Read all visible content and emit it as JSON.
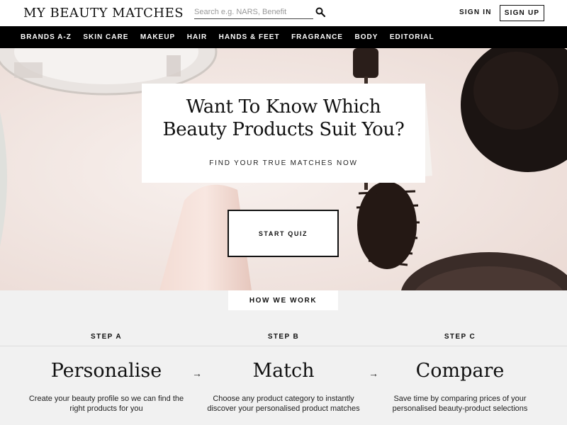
{
  "header": {
    "logo": "MY BEAUTY MATCHES",
    "search_placeholder": "Search e.g. NARS, Benefit",
    "sign_in": "SIGN IN",
    "sign_up": "SIGN UP"
  },
  "nav": {
    "items": [
      "BRANDS A-Z",
      "SKIN CARE",
      "MAKEUP",
      "HAIR",
      "HANDS & FEET",
      "FRAGRANCE",
      "BODY",
      "EDITORIAL"
    ]
  },
  "hero": {
    "title_line1": "Want To Know Which",
    "title_line2": "Beauty Products Suit You?",
    "subtitle": "FIND YOUR TRUE MATCHES NOW",
    "cta": "START QUIZ"
  },
  "how": {
    "label": "HOW WE WORK",
    "steps": [
      {
        "label": "STEP A",
        "title": "Personalise",
        "desc": "Create your beauty profile so we can find the right products for you"
      },
      {
        "label": "STEP B",
        "title": "Match",
        "desc": "Choose any product category to instantly discover your personalised product matches"
      },
      {
        "label": "STEP C",
        "title": "Compare",
        "desc": "Save time by comparing prices of your personalised beauty-product selections"
      }
    ],
    "arrow": "→"
  },
  "colors": {
    "black": "#000000",
    "background": "#f1f1f1",
    "hero_bg": "#efe6e2"
  }
}
